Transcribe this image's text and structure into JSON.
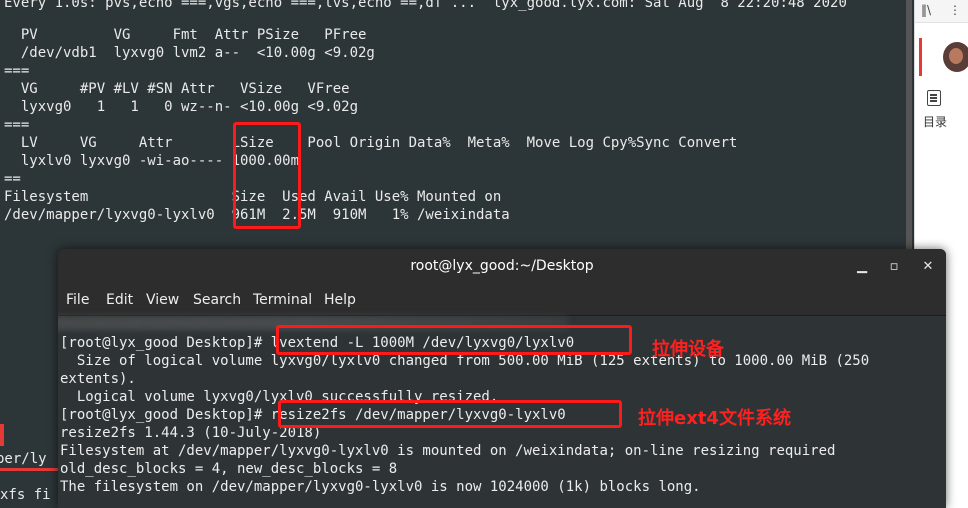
{
  "background_terminal": {
    "lines": [
      "Every 1.0s: pvs,echo ===,vgs,echo ===,lvs,echo ==,df ...  lyx_good.lyx.com: Sat Aug  8 22:20:48 2020",
      "",
      "  PV         VG     Fmt  Attr PSize   PFree",
      "  /dev/vdb1  lyxvg0 lvm2 a--  <10.00g <9.02g",
      "===",
      "  VG     #PV #LV #SN Attr   VSize   VFree",
      "  lyxvg0   1   1   0 wz--n- <10.00g <9.02g",
      "===",
      "  LV     VG     Attr       LSize    Pool Origin Data%  Meta%  Move Log Cpy%Sync Convert",
      "  lyxlv0 lyxvg0 -wi-ao---- 1000.00m",
      "==",
      "Filesystem                 Size  Used Avail Use% Mounted on",
      "/dev/mapper/lyxvg0-lyxlv0  961M  2.5M  910M   1% /weixindata"
    ],
    "left_edge_fragments": [
      "",
      "per/ly",
      "xfs fi"
    ]
  },
  "right_panel": {
    "toc_label": "目录",
    "top_icon": "bookshelf-icon",
    "menu_icon": "more-vertical-icon"
  },
  "window": {
    "title": "root@lyx_good:~/Desktop",
    "buttons": [
      "minimize-icon",
      "maximize-icon",
      "close-icon"
    ],
    "button_glyphs": [
      "▁",
      "▫",
      "✕"
    ],
    "menu": [
      "File",
      "Edit",
      "View",
      "Search",
      "Terminal",
      "Help"
    ]
  },
  "terminal": {
    "lines": [
      "",
      "[root@lyx_good Desktop]# lvextend -L 1000M /dev/lyxvg0/lyxlv0",
      "  Size of logical volume lyxvg0/lyxlv0 changed from 500.00 MiB (125 extents) to 1000.00 MiB (250",
      "extents).",
      "  Logical volume lyxvg0/lyxlv0 successfully resized.",
      "[root@lyx_good Desktop]# resize2fs /dev/mapper/lyxvg0-lyxlv0",
      "resize2fs 1.44.3 (10-July-2018)",
      "Filesystem at /dev/mapper/lyxvg0-lyxlv0 is mounted on /weixindata; on-line resizing required",
      "old_desc_blocks = 4, new_desc_blocks = 8",
      "The filesystem on /dev/mapper/lyxvg0-lyxlv0 is now 1024000 (1k) blocks long."
    ]
  },
  "annotations": {
    "stretch_device": "拉伸设备",
    "stretch_ext4": "拉伸ext4文件系统",
    "highlight_color": "#ff1a1a"
  }
}
